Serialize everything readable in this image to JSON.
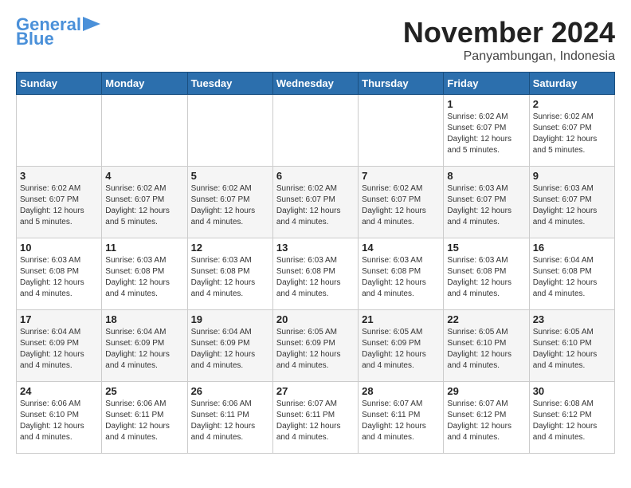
{
  "logo": {
    "line1": "General",
    "line2": "Blue"
  },
  "title": "November 2024",
  "subtitle": "Panyambungan, Indonesia",
  "days_of_week": [
    "Sunday",
    "Monday",
    "Tuesday",
    "Wednesday",
    "Thursday",
    "Friday",
    "Saturday"
  ],
  "weeks": [
    [
      {
        "day": "",
        "info": ""
      },
      {
        "day": "",
        "info": ""
      },
      {
        "day": "",
        "info": ""
      },
      {
        "day": "",
        "info": ""
      },
      {
        "day": "",
        "info": ""
      },
      {
        "day": "1",
        "info": "Sunrise: 6:02 AM\nSunset: 6:07 PM\nDaylight: 12 hours and 5 minutes."
      },
      {
        "day": "2",
        "info": "Sunrise: 6:02 AM\nSunset: 6:07 PM\nDaylight: 12 hours and 5 minutes."
      }
    ],
    [
      {
        "day": "3",
        "info": "Sunrise: 6:02 AM\nSunset: 6:07 PM\nDaylight: 12 hours and 5 minutes."
      },
      {
        "day": "4",
        "info": "Sunrise: 6:02 AM\nSunset: 6:07 PM\nDaylight: 12 hours and 5 minutes."
      },
      {
        "day": "5",
        "info": "Sunrise: 6:02 AM\nSunset: 6:07 PM\nDaylight: 12 hours and 4 minutes."
      },
      {
        "day": "6",
        "info": "Sunrise: 6:02 AM\nSunset: 6:07 PM\nDaylight: 12 hours and 4 minutes."
      },
      {
        "day": "7",
        "info": "Sunrise: 6:02 AM\nSunset: 6:07 PM\nDaylight: 12 hours and 4 minutes."
      },
      {
        "day": "8",
        "info": "Sunrise: 6:03 AM\nSunset: 6:07 PM\nDaylight: 12 hours and 4 minutes."
      },
      {
        "day": "9",
        "info": "Sunrise: 6:03 AM\nSunset: 6:07 PM\nDaylight: 12 hours and 4 minutes."
      }
    ],
    [
      {
        "day": "10",
        "info": "Sunrise: 6:03 AM\nSunset: 6:08 PM\nDaylight: 12 hours and 4 minutes."
      },
      {
        "day": "11",
        "info": "Sunrise: 6:03 AM\nSunset: 6:08 PM\nDaylight: 12 hours and 4 minutes."
      },
      {
        "day": "12",
        "info": "Sunrise: 6:03 AM\nSunset: 6:08 PM\nDaylight: 12 hours and 4 minutes."
      },
      {
        "day": "13",
        "info": "Sunrise: 6:03 AM\nSunset: 6:08 PM\nDaylight: 12 hours and 4 minutes."
      },
      {
        "day": "14",
        "info": "Sunrise: 6:03 AM\nSunset: 6:08 PM\nDaylight: 12 hours and 4 minutes."
      },
      {
        "day": "15",
        "info": "Sunrise: 6:03 AM\nSunset: 6:08 PM\nDaylight: 12 hours and 4 minutes."
      },
      {
        "day": "16",
        "info": "Sunrise: 6:04 AM\nSunset: 6:08 PM\nDaylight: 12 hours and 4 minutes."
      }
    ],
    [
      {
        "day": "17",
        "info": "Sunrise: 6:04 AM\nSunset: 6:09 PM\nDaylight: 12 hours and 4 minutes."
      },
      {
        "day": "18",
        "info": "Sunrise: 6:04 AM\nSunset: 6:09 PM\nDaylight: 12 hours and 4 minutes."
      },
      {
        "day": "19",
        "info": "Sunrise: 6:04 AM\nSunset: 6:09 PM\nDaylight: 12 hours and 4 minutes."
      },
      {
        "day": "20",
        "info": "Sunrise: 6:05 AM\nSunset: 6:09 PM\nDaylight: 12 hours and 4 minutes."
      },
      {
        "day": "21",
        "info": "Sunrise: 6:05 AM\nSunset: 6:09 PM\nDaylight: 12 hours and 4 minutes."
      },
      {
        "day": "22",
        "info": "Sunrise: 6:05 AM\nSunset: 6:10 PM\nDaylight: 12 hours and 4 minutes."
      },
      {
        "day": "23",
        "info": "Sunrise: 6:05 AM\nSunset: 6:10 PM\nDaylight: 12 hours and 4 minutes."
      }
    ],
    [
      {
        "day": "24",
        "info": "Sunrise: 6:06 AM\nSunset: 6:10 PM\nDaylight: 12 hours and 4 minutes."
      },
      {
        "day": "25",
        "info": "Sunrise: 6:06 AM\nSunset: 6:11 PM\nDaylight: 12 hours and 4 minutes."
      },
      {
        "day": "26",
        "info": "Sunrise: 6:06 AM\nSunset: 6:11 PM\nDaylight: 12 hours and 4 minutes."
      },
      {
        "day": "27",
        "info": "Sunrise: 6:07 AM\nSunset: 6:11 PM\nDaylight: 12 hours and 4 minutes."
      },
      {
        "day": "28",
        "info": "Sunrise: 6:07 AM\nSunset: 6:11 PM\nDaylight: 12 hours and 4 minutes."
      },
      {
        "day": "29",
        "info": "Sunrise: 6:07 AM\nSunset: 6:12 PM\nDaylight: 12 hours and 4 minutes."
      },
      {
        "day": "30",
        "info": "Sunrise: 6:08 AM\nSunset: 6:12 PM\nDaylight: 12 hours and 4 minutes."
      }
    ]
  ]
}
